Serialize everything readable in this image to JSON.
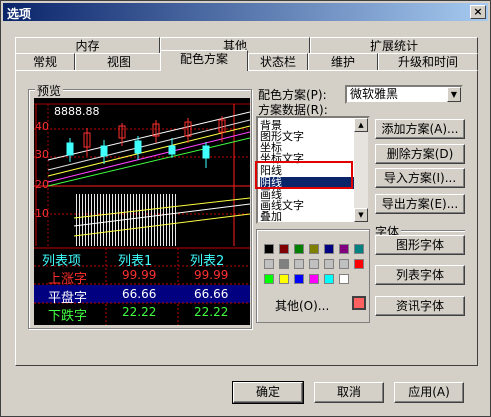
{
  "window": {
    "title": "选项",
    "close": "×"
  },
  "tabs_row1": [
    {
      "label": "内存"
    },
    {
      "label": "其他"
    },
    {
      "label": "扩展统计"
    }
  ],
  "tabs_row2": [
    {
      "label": "常规"
    },
    {
      "label": "视图"
    },
    {
      "label": "配色方案"
    },
    {
      "label": "状态栏"
    },
    {
      "label": "维护"
    },
    {
      "label": "升级和时间"
    }
  ],
  "preview": {
    "group_label": "预览",
    "price_label": "8888.88",
    "axis_labels": [
      "40",
      "30",
      "20",
      "10"
    ],
    "table": {
      "headers": [
        "列表项",
        "列表1",
        "列表2"
      ],
      "rows": [
        {
          "name": "上涨字",
          "v1": "99.99",
          "v2": "99.99"
        },
        {
          "name": "平盘字",
          "v1": "66.66",
          "v2": "66.66"
        },
        {
          "name": "下跌字",
          "v1": "22.22",
          "v2": "22.22"
        }
      ]
    }
  },
  "scheme": {
    "scheme_label": "配色方案(P):",
    "scheme_value": "微软雅黑",
    "data_label": "方案数据(R):",
    "list": [
      "背景",
      "图形文字",
      "坐标",
      "坐标文字",
      "阳线",
      "阴线",
      "画线",
      "画线文字",
      "叠加"
    ],
    "selected_index": 5
  },
  "colors": {
    "other_label": "其他(O)...",
    "palette": [
      "#000000",
      "#800000",
      "#008000",
      "#808000",
      "#000080",
      "#800080",
      "#008080",
      "#c0c0c0",
      "#808080",
      "#ff0000",
      "#00ff00",
      "#ffff00",
      "#0000ff",
      "#ff00ff",
      "#00ffff",
      "#ffffff"
    ],
    "current": "#ff6060"
  },
  "scheme_buttons": {
    "add": "添加方案(A)...",
    "delete": "删除方案(D)",
    "import": "导入方案(I)...",
    "export": "导出方案(E)..."
  },
  "font": {
    "group_label": "字体",
    "graph_font": "图形字体",
    "list_font": "列表字体",
    "info_font": "资讯字体"
  },
  "footer": {
    "ok": "确定",
    "cancel": "取消",
    "apply": "应用(A)"
  }
}
